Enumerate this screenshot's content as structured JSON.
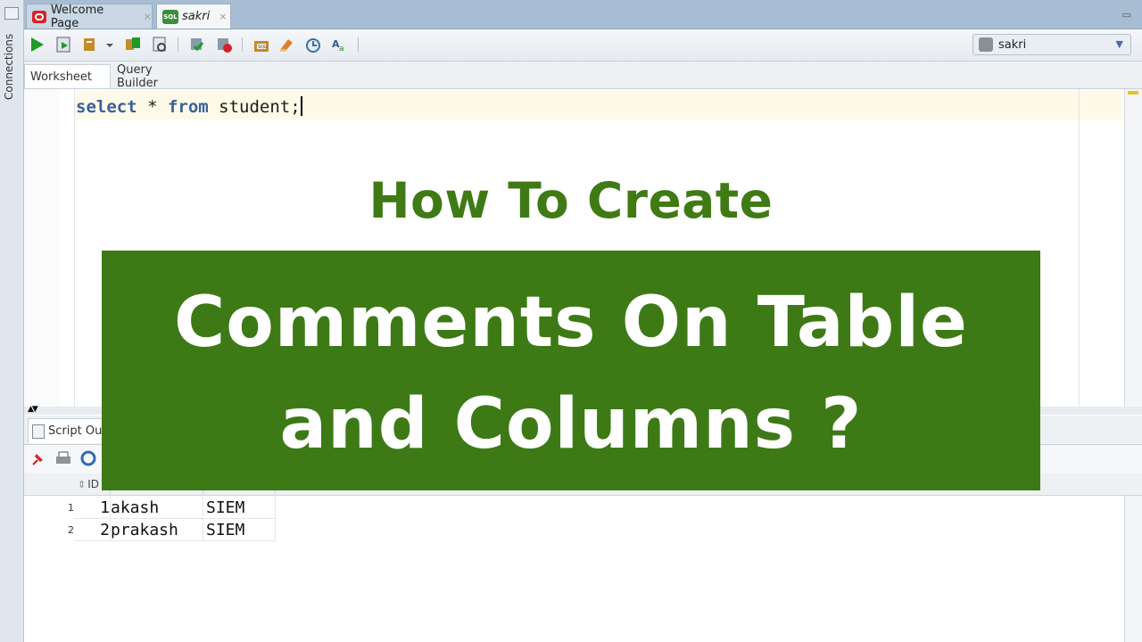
{
  "rail": {
    "label": "Connections"
  },
  "tabs": [
    {
      "label": "Welcome Page",
      "close": "×"
    },
    {
      "label": "sakri",
      "close": "×"
    }
  ],
  "toolbar": {
    "connection": "sakri"
  },
  "subtabs": [
    "Worksheet",
    "Query Builder"
  ],
  "editor": {
    "tokens": {
      "k1": "select",
      "t1": " * ",
      "k2": "from",
      "t2": " student;"
    }
  },
  "output": {
    "tab_label": "Script Out"
  },
  "grid": {
    "headers": [
      "ID",
      "",
      ""
    ],
    "rows": [
      {
        "num": "1",
        "id": "1",
        "name": "akash",
        "dept": "SIEM"
      },
      {
        "num": "2",
        "id": "2",
        "name": "prakash",
        "dept": "SIEM"
      }
    ]
  },
  "overlay": {
    "subtitle": "How To Create",
    "line1": "Comments On Table",
    "line2": "and Columns ?"
  },
  "colors": {
    "banner": "#3d7a16",
    "subtitle": "#3f7a14",
    "keyword": "#3b5fa0"
  },
  "icons": [
    "run-icon",
    "run-script-icon",
    "commit-icon",
    "rollback-icon",
    "autotrace-icon",
    "explain-plan-icon",
    "clear-icon",
    "history-icon",
    "format-icon",
    "pin-icon",
    "print-icon",
    "refresh-icon"
  ]
}
